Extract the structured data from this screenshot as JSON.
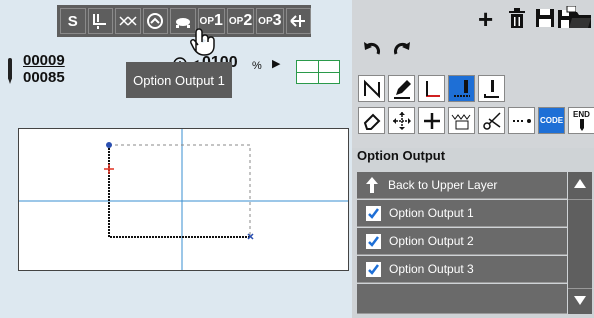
{
  "toolbar": {
    "s_label": "S",
    "op1_prefix": "OP",
    "op1_num": "1",
    "op2_prefix": "OP",
    "op2_num": "2",
    "op3_prefix": "OP",
    "op3_num": "3"
  },
  "counter": {
    "top": "00009",
    "bottom": "00085"
  },
  "tooltip": "Option Output 1",
  "speed": {
    "value": "0100",
    "unit": "%"
  },
  "option_panel": {
    "title": "Option Output",
    "back_label": "Back to Upper Layer",
    "items": [
      {
        "label": "Option Output 1",
        "checked": true
      },
      {
        "label": "Option Output 2",
        "checked": true
      },
      {
        "label": "Option Output 3",
        "checked": true
      }
    ]
  },
  "icons": {
    "code_label": "CODE",
    "end_label": "END"
  },
  "colors": {
    "accent": "#1e6fd6",
    "panel_row": "#6a6a6a",
    "toolbar": "#5e5e5e"
  }
}
